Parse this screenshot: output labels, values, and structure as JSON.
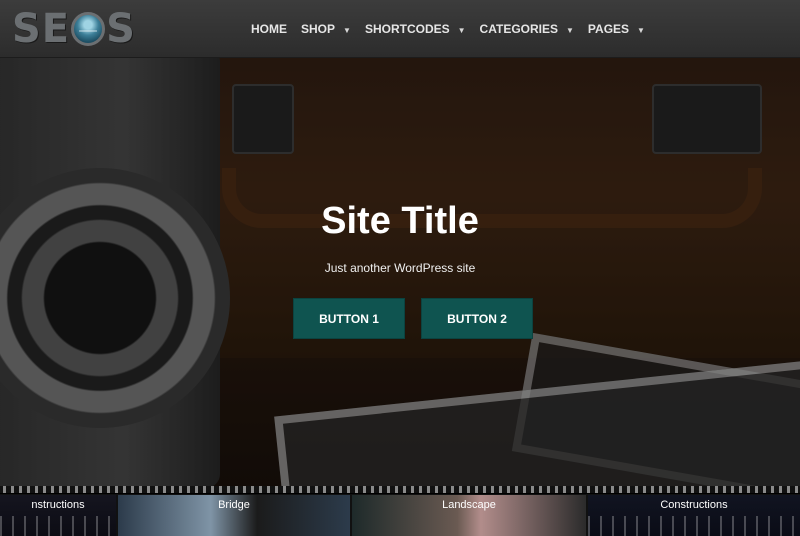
{
  "logo": {
    "text_left": "SE",
    "text_right": "S"
  },
  "nav": {
    "items": [
      {
        "label": "HOME",
        "has_dropdown": false
      },
      {
        "label": "SHOP",
        "has_dropdown": true
      },
      {
        "label": "SHORTCODES",
        "has_dropdown": true
      },
      {
        "label": "CATEGORIES",
        "has_dropdown": true
      },
      {
        "label": "PAGES",
        "has_dropdown": true
      }
    ]
  },
  "hero": {
    "title": "Site Title",
    "subtitle": "Just another WordPress site",
    "button1": "BUTTON 1",
    "button2": "BUTTON 2"
  },
  "strip": {
    "frames": [
      {
        "label": "nstructions"
      },
      {
        "label": "Bridge"
      },
      {
        "label": "Landscape"
      },
      {
        "label": "Constructions"
      }
    ]
  },
  "colors": {
    "header_bg": "#333333",
    "button_bg": "#0f5450",
    "logo_gray": "#6b6f72"
  }
}
